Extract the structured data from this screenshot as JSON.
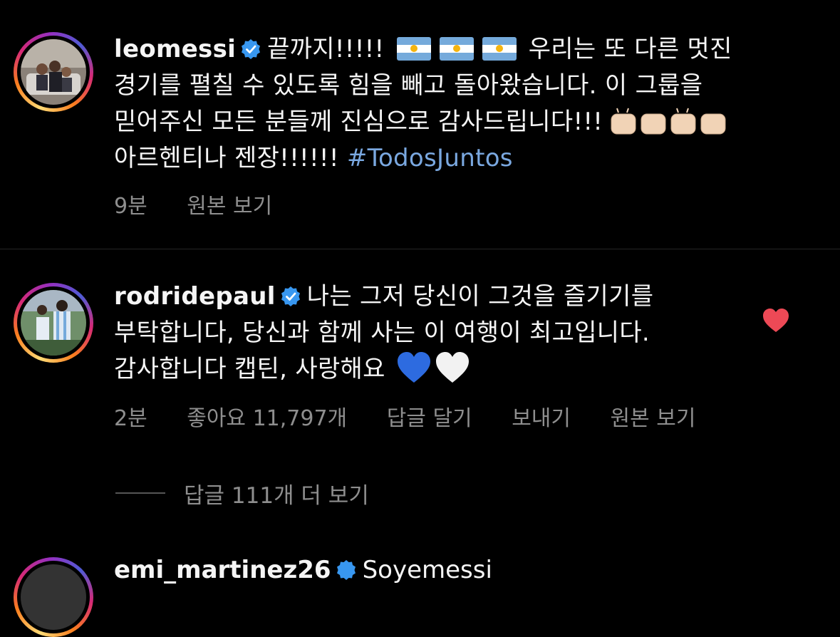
{
  "comments": [
    {
      "username": "leomessi",
      "verified": true,
      "text_part1": "끝까지!!!!!",
      "text_part2": "우리는 또 다른 멋진 경기를 펼칠 수 있도록 힘을 빼고 돌아왔습니다. 이 그룹을 믿어주신 모든 분들께 진심으로 감사드립니다!!!",
      "text_part3": "아르헨티나 젠장!!!!!!",
      "hashtag": "#TodosJuntos",
      "emoji": [
        "argentina-flag-icon",
        "argentina-flag-icon",
        "argentina-flag-icon",
        "raised-hands-icon"
      ],
      "time": "9분",
      "see_original": "원본 보기"
    },
    {
      "username": "rodridepaul",
      "verified": true,
      "text": "나는 그저 당신이 그것을 즐기기를 부탁합니다, 당신과 함께 사는 이 여행이 최고입니다. 감사합니다 캡틴, 사랑해요",
      "emoji": [
        "blue-heart-icon",
        "white-heart-icon"
      ],
      "liked": true,
      "like_color": "#ed4956",
      "time": "2분",
      "likes": "좋아요 11,797개",
      "reply": "답글 달기",
      "send": "보내기",
      "see_original": "원본 보기"
    }
  ],
  "view_replies": "답글 111개 더 보기",
  "next_username": "emi_martinez26",
  "next_text": "Soyemessi",
  "colors": {
    "background": "#000000",
    "text": "#f5f5f5",
    "meta": "#8e8e8e",
    "hashtag": "#7aa8e0",
    "verified": "#3897f0"
  }
}
